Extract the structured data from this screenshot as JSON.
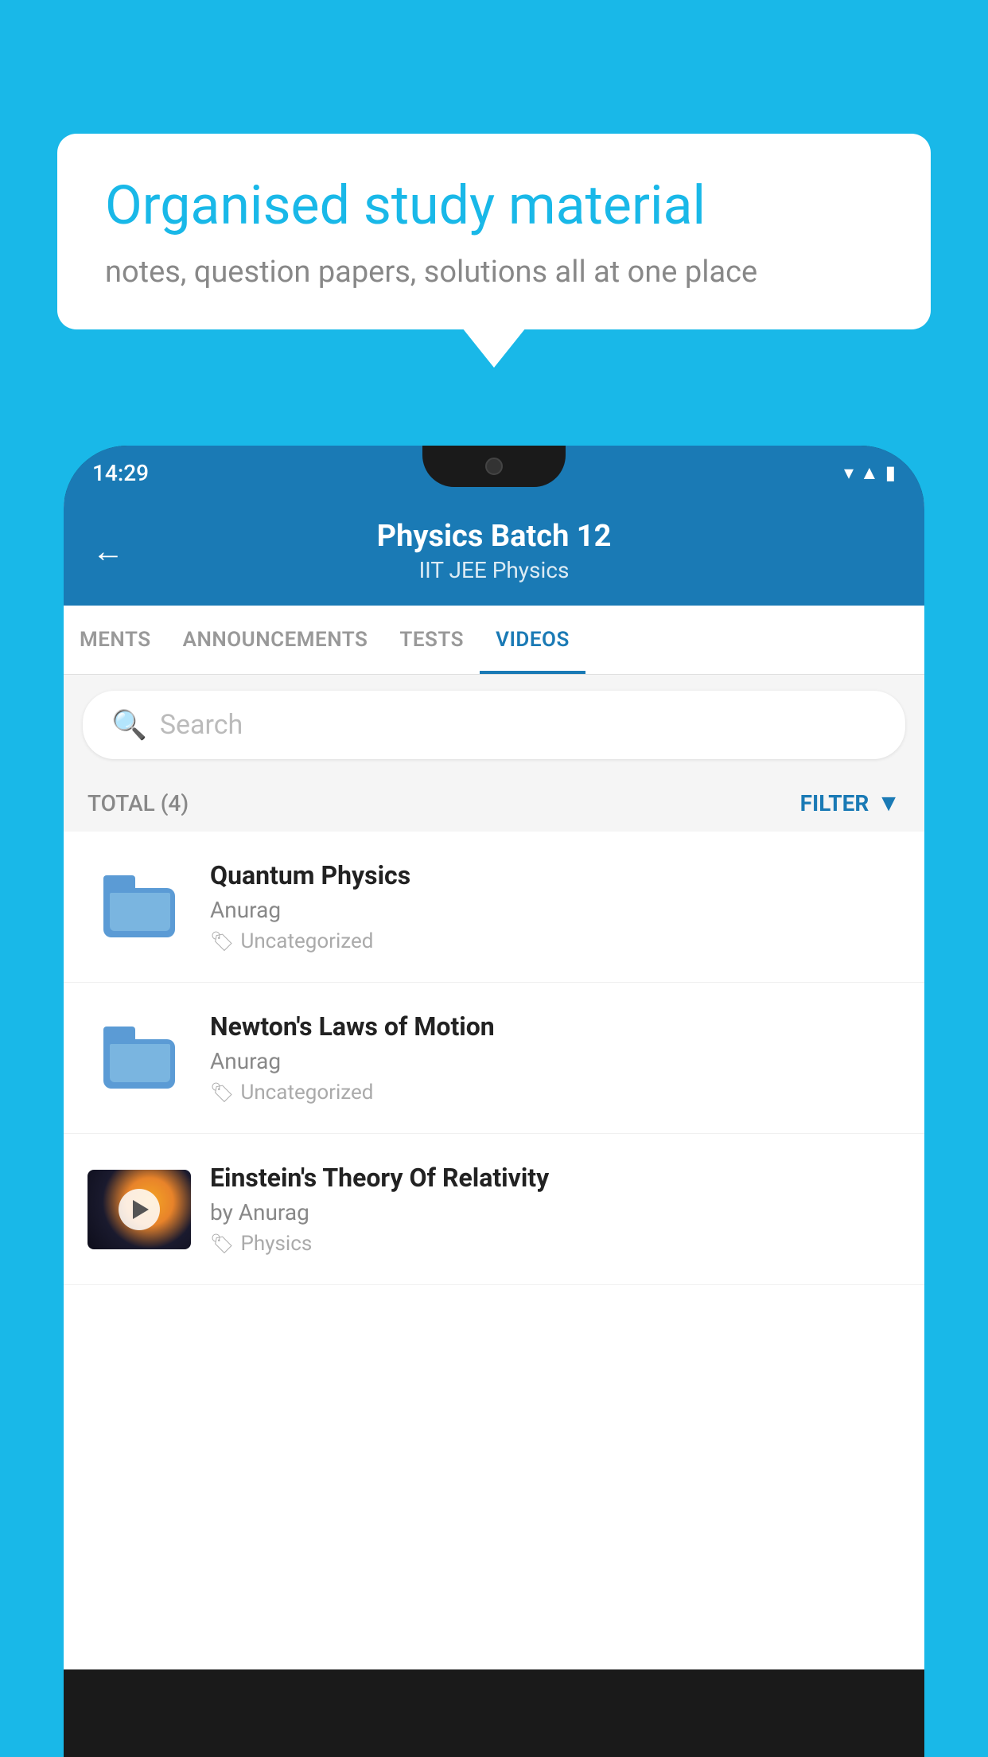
{
  "background": {
    "color": "#19b8e8"
  },
  "speech_bubble": {
    "title": "Organised study material",
    "subtitle": "notes, question papers, solutions all at one place"
  },
  "phone": {
    "status_bar": {
      "time": "14:29",
      "icons": [
        "wifi",
        "signal",
        "battery"
      ]
    },
    "header": {
      "back_label": "←",
      "title": "Physics Batch 12",
      "subtitle": "IIT JEE   Physics"
    },
    "tabs": [
      {
        "label": "MENTS",
        "active": false
      },
      {
        "label": "ANNOUNCEMENTS",
        "active": false
      },
      {
        "label": "TESTS",
        "active": false
      },
      {
        "label": "VIDEOS",
        "active": true
      }
    ],
    "search": {
      "placeholder": "Search"
    },
    "filter": {
      "total_label": "TOTAL (4)",
      "filter_label": "FILTER"
    },
    "videos": [
      {
        "type": "folder",
        "title": "Quantum Physics",
        "author": "Anurag",
        "tag": "Uncategorized"
      },
      {
        "type": "folder",
        "title": "Newton's Laws of Motion",
        "author": "Anurag",
        "tag": "Uncategorized"
      },
      {
        "type": "video",
        "title": "Einstein's Theory Of Relativity",
        "author": "by Anurag",
        "tag": "Physics"
      }
    ]
  }
}
